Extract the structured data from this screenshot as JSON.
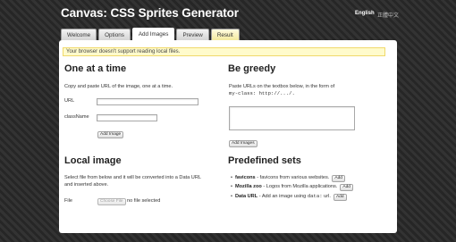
{
  "header": {
    "title": "Canvas: CSS Sprites Generator",
    "languages": [
      "English",
      "正體中文"
    ]
  },
  "tabs": [
    {
      "label": "Welcome",
      "active": false
    },
    {
      "label": "Options",
      "active": false
    },
    {
      "label": "Add Images",
      "active": true
    },
    {
      "label": "Preview",
      "active": false
    },
    {
      "label": "Result",
      "active": false
    }
  ],
  "warning": "Your browser doesn't support reading local files.",
  "one_at_a_time": {
    "heading": "One at a time",
    "description": "Copy and paste URL of the image, one at a time.",
    "url_label": "URL",
    "url_value": "",
    "classname_label": "className",
    "classname_value": "",
    "button": "Add Image"
  },
  "be_greedy": {
    "heading": "Be greedy",
    "desc_line1": "Paste URLs on the textbox below, in the form of",
    "desc_code": "my-class: http://.../.",
    "textarea_value": "",
    "button": "Add Images"
  },
  "local_image": {
    "heading": "Local image",
    "desc_line1": "Select file from below and it will be converted into a Data URL",
    "desc_line2": "and inserted above.",
    "file_label": "File",
    "choose_button": "Choose File",
    "no_file": "no file selected"
  },
  "predefined": {
    "heading": "Predefined sets",
    "items": [
      {
        "name": "favicons",
        "desc": " - favicons from various websites.",
        "button": "Add"
      },
      {
        "name": "Mozilla zoo",
        "desc": " - Logos from Mozilla applications.",
        "button": "Add"
      },
      {
        "name": "Data URL",
        "desc_pre": " - Add an image using ",
        "desc_code": "data:",
        "desc_post": " url.",
        "button": "Add"
      }
    ]
  }
}
